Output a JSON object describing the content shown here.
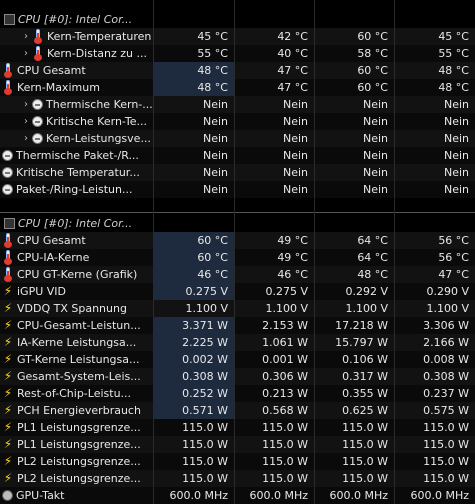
{
  "section1": {
    "title": "CPU [#0]: Intel Cor...",
    "rows": [
      {
        "label": "Kern-Temperaturen",
        "indent": 1,
        "chev": true,
        "icon": "thermometer-icon",
        "v": [
          "45 °C",
          "42 °C",
          "60 °C",
          "45 °C"
        ]
      },
      {
        "label": "Kern-Distanz zu ...",
        "indent": 1,
        "chev": true,
        "icon": "thermometer-icon",
        "v": [
          "55 °C",
          "40 °C",
          "58 °C",
          "55 °C"
        ]
      },
      {
        "label": "CPU Gesamt",
        "indent": 0,
        "chev": false,
        "icon": "thermometer-icon",
        "shade": true,
        "v": [
          "48 °C",
          "47 °C",
          "60 °C",
          "48 °C"
        ]
      },
      {
        "label": "Kern-Maximum",
        "indent": 0,
        "chev": false,
        "icon": "thermometer-icon",
        "shade": true,
        "v": [
          "48 °C",
          "47 °C",
          "60 °C",
          "48 °C"
        ]
      },
      {
        "label": "Thermische Kern-...",
        "indent": 1,
        "chev": true,
        "icon": "status-circle-icon",
        "v": [
          "Nein",
          "Nein",
          "Nein",
          "Nein"
        ]
      },
      {
        "label": "Kritische Kern-Te...",
        "indent": 1,
        "chev": true,
        "icon": "status-circle-icon",
        "v": [
          "Nein",
          "Nein",
          "Nein",
          "Nein"
        ]
      },
      {
        "label": "Kern-Leistungsve...",
        "indent": 1,
        "chev": true,
        "icon": "status-circle-icon",
        "v": [
          "Nein",
          "Nein",
          "Nein",
          "Nein"
        ]
      },
      {
        "label": "Thermische Paket-/R...",
        "indent": 0,
        "chev": false,
        "icon": "status-circle-icon",
        "v": [
          "Nein",
          "Nein",
          "Nein",
          "Nein"
        ]
      },
      {
        "label": "Kritische Temperatur...",
        "indent": 0,
        "chev": false,
        "icon": "status-circle-icon",
        "v": [
          "Nein",
          "Nein",
          "Nein",
          "Nein"
        ]
      },
      {
        "label": "Paket-/Ring-Leistun...",
        "indent": 0,
        "chev": false,
        "icon": "status-circle-icon",
        "v": [
          "Nein",
          "Nein",
          "Nein",
          "Nein"
        ]
      }
    ]
  },
  "section2": {
    "title": "CPU [#0]: Intel Cor...",
    "rows": [
      {
        "label": "CPU Gesamt",
        "icon": "thermometer-icon",
        "shade": true,
        "v": [
          "60 °C",
          "49 °C",
          "64 °C",
          "56 °C"
        ]
      },
      {
        "label": "CPU-IA-Kerne",
        "icon": "thermometer-icon",
        "shade": true,
        "v": [
          "60 °C",
          "49 °C",
          "64 °C",
          "56 °C"
        ]
      },
      {
        "label": "CPU GT-Kerne (Grafik)",
        "icon": "thermometer-icon",
        "shade": true,
        "v": [
          "46 °C",
          "46 °C",
          "48 °C",
          "47 °C"
        ]
      },
      {
        "label": "iGPU VID",
        "icon": "lightning-icon",
        "shade": true,
        "v": [
          "0.275 V",
          "0.275 V",
          "0.292 V",
          "0.290 V"
        ]
      },
      {
        "label": "VDDQ TX Spannung",
        "icon": "lightning-icon",
        "shade": false,
        "v": [
          "1.100 V",
          "1.100 V",
          "1.100 V",
          "1.100 V"
        ]
      },
      {
        "label": "CPU-Gesamt-Leistun...",
        "icon": "lightning-icon",
        "shade": true,
        "v": [
          "3.371 W",
          "2.153 W",
          "17.218 W",
          "3.306 W"
        ]
      },
      {
        "label": "IA-Kerne Leistungsa...",
        "icon": "lightning-icon",
        "shade": true,
        "v": [
          "2.225 W",
          "1.061 W",
          "15.797 W",
          "2.166 W"
        ]
      },
      {
        "label": "GT-Kerne Leistungsa...",
        "icon": "lightning-icon",
        "shade": true,
        "v": [
          "0.002 W",
          "0.001 W",
          "0.106 W",
          "0.008 W"
        ]
      },
      {
        "label": "Gesamt-System-Leis...",
        "icon": "lightning-icon",
        "shade": true,
        "v": [
          "0.308 W",
          "0.306 W",
          "0.317 W",
          "0.308 W"
        ]
      },
      {
        "label": "Rest-of-Chip-Leistu...",
        "icon": "lightning-icon",
        "shade": true,
        "v": [
          "0.252 W",
          "0.213 W",
          "0.355 W",
          "0.237 W"
        ]
      },
      {
        "label": "PCH Energieverbrauch",
        "icon": "lightning-icon",
        "shade": true,
        "v": [
          "0.571 W",
          "0.568 W",
          "0.625 W",
          "0.575 W"
        ]
      },
      {
        "label": "PL1 Leistungsgrenze...",
        "icon": "lightning-icon",
        "shade": false,
        "v": [
          "115.0 W",
          "115.0 W",
          "115.0 W",
          "115.0 W"
        ]
      },
      {
        "label": "PL1 Leistungsgrenze...",
        "icon": "lightning-icon",
        "shade": false,
        "v": [
          "115.0 W",
          "115.0 W",
          "115.0 W",
          "115.0 W"
        ]
      },
      {
        "label": "PL2 Leistungsgrenze...",
        "icon": "lightning-icon",
        "shade": false,
        "v": [
          "115.0 W",
          "115.0 W",
          "115.0 W",
          "115.0 W"
        ]
      },
      {
        "label": "PL2 Leistungsgrenze...",
        "icon": "lightning-icon",
        "shade": false,
        "v": [
          "115.0 W",
          "115.0 W",
          "115.0 W",
          "115.0 W"
        ]
      },
      {
        "label": "GPU-Takt",
        "icon": "clock-icon",
        "shade": false,
        "v": [
          "600.0 MHz",
          "600.0 MHz",
          "600.0 MHz",
          "600.0 MHz"
        ]
      }
    ]
  }
}
